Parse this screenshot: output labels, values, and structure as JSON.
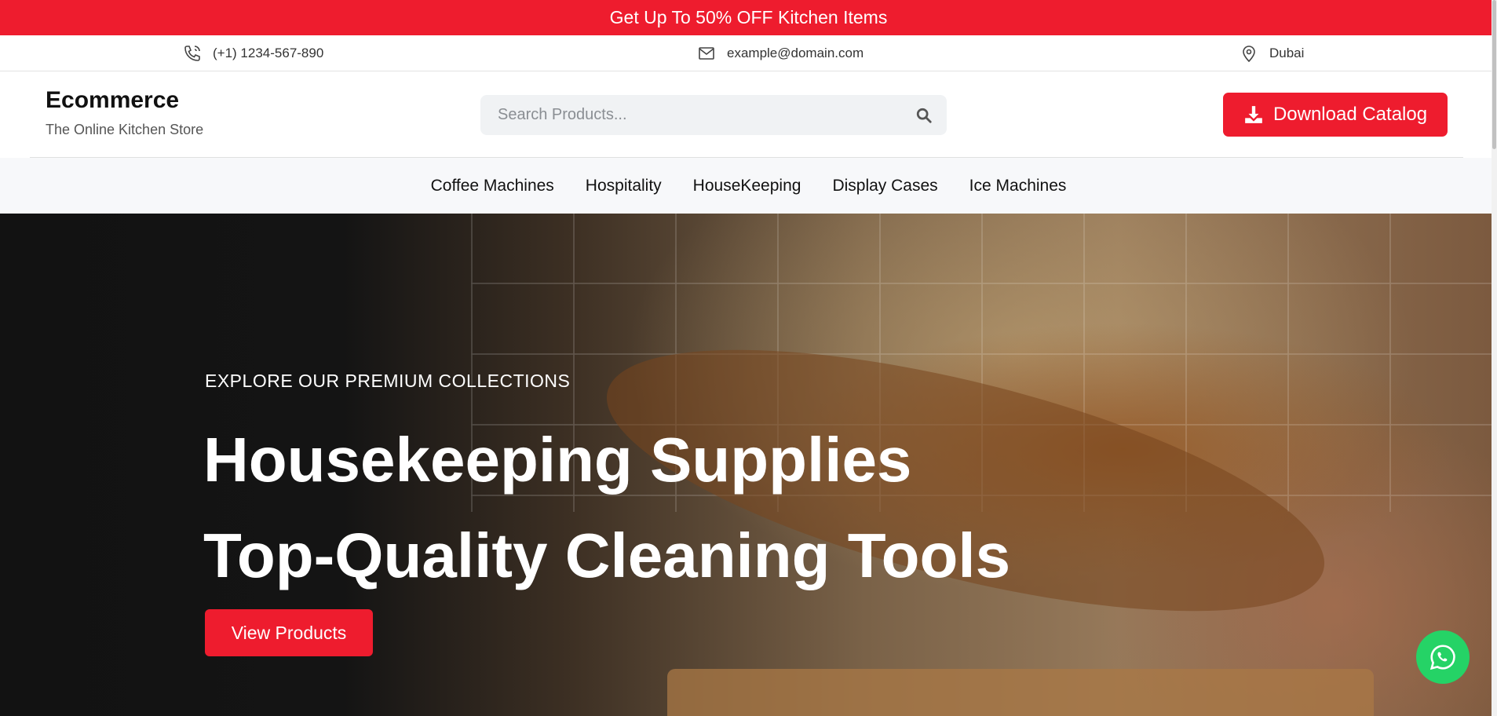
{
  "promo": {
    "text": "Get Up To 50% OFF Kitchen Items"
  },
  "contact": {
    "phone": "(+1) 1234-567-890",
    "email": "example@domain.com",
    "location": "Dubai"
  },
  "brand": {
    "name": "Ecommerce",
    "tagline": "The Online Kitchen Store"
  },
  "search": {
    "placeholder": "Search Products...",
    "value": ""
  },
  "download": {
    "label": "Download Catalog"
  },
  "nav": {
    "items": [
      {
        "label": "Coffee Machines"
      },
      {
        "label": "Hospitality"
      },
      {
        "label": "HouseKeeping"
      },
      {
        "label": "Display Cases"
      },
      {
        "label": "Ice Machines"
      }
    ]
  },
  "hero": {
    "eyebrow": "EXPLORE OUR PREMIUM COLLECTIONS",
    "title_line1": "Housekeeping Supplies",
    "title_line2": "Top-Quality Cleaning Tools",
    "cta_label": "View Products"
  },
  "icons": {
    "phone": "phone-icon",
    "email": "mail-icon",
    "location": "map-pin-icon",
    "search": "search-icon",
    "download": "download-icon",
    "whatsapp": "whatsapp-icon"
  },
  "colors": {
    "accent": "#ee1c2e",
    "whatsapp": "#25d366",
    "nav_bg": "#f7f8fa"
  }
}
